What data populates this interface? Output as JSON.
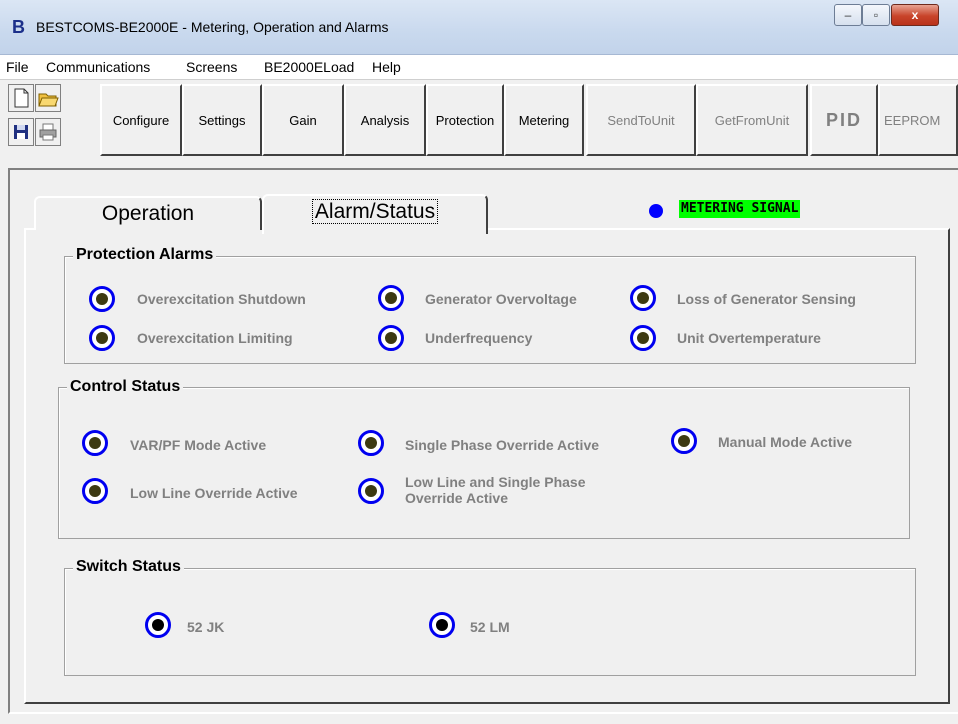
{
  "window": {
    "title": "BESTCOMS-BE2000E - Metering, Operation and Alarms",
    "icon_letter": "B",
    "controls": {
      "minimize": "–",
      "maximize": "▫",
      "close": "x"
    }
  },
  "menu": [
    "File",
    "Communications",
    "Screens",
    "BE2000ELoad",
    "Help"
  ],
  "toolbar": {
    "buttons": [
      "Configure",
      "Settings",
      "Gain",
      "Analysis",
      "Protection",
      "Metering",
      "SendToUnit",
      "GetFromUnit",
      "PID",
      "EEPROM"
    ]
  },
  "tabs": [
    "Operation",
    "Alarm/Status"
  ],
  "signal": {
    "label": "METERING SIGNAL",
    "color": "#0000ff",
    "bg": "#00ff00"
  },
  "protection_alarms": {
    "title": "Protection Alarms",
    "items": [
      "Overexcitation Shutdown",
      "Generator Overvoltage",
      "Loss of Generator Sensing",
      "Overexcitation Limiting",
      "Underfrequency",
      "Unit Overtemperature"
    ]
  },
  "control_status": {
    "title": "Control Status",
    "items": [
      "VAR/PF Mode Active",
      "Single Phase Override Active",
      "Manual Mode Active",
      "Low Line Override Active",
      "Low Line and Single Phase",
      "Override Active"
    ]
  },
  "switch_status": {
    "title": "Switch Status",
    "items": [
      "52 JK",
      "52 LM"
    ]
  },
  "colors": {
    "led_ring": "#0000f0",
    "led_off": "#3d3a12",
    "label_gray": "#808080"
  }
}
